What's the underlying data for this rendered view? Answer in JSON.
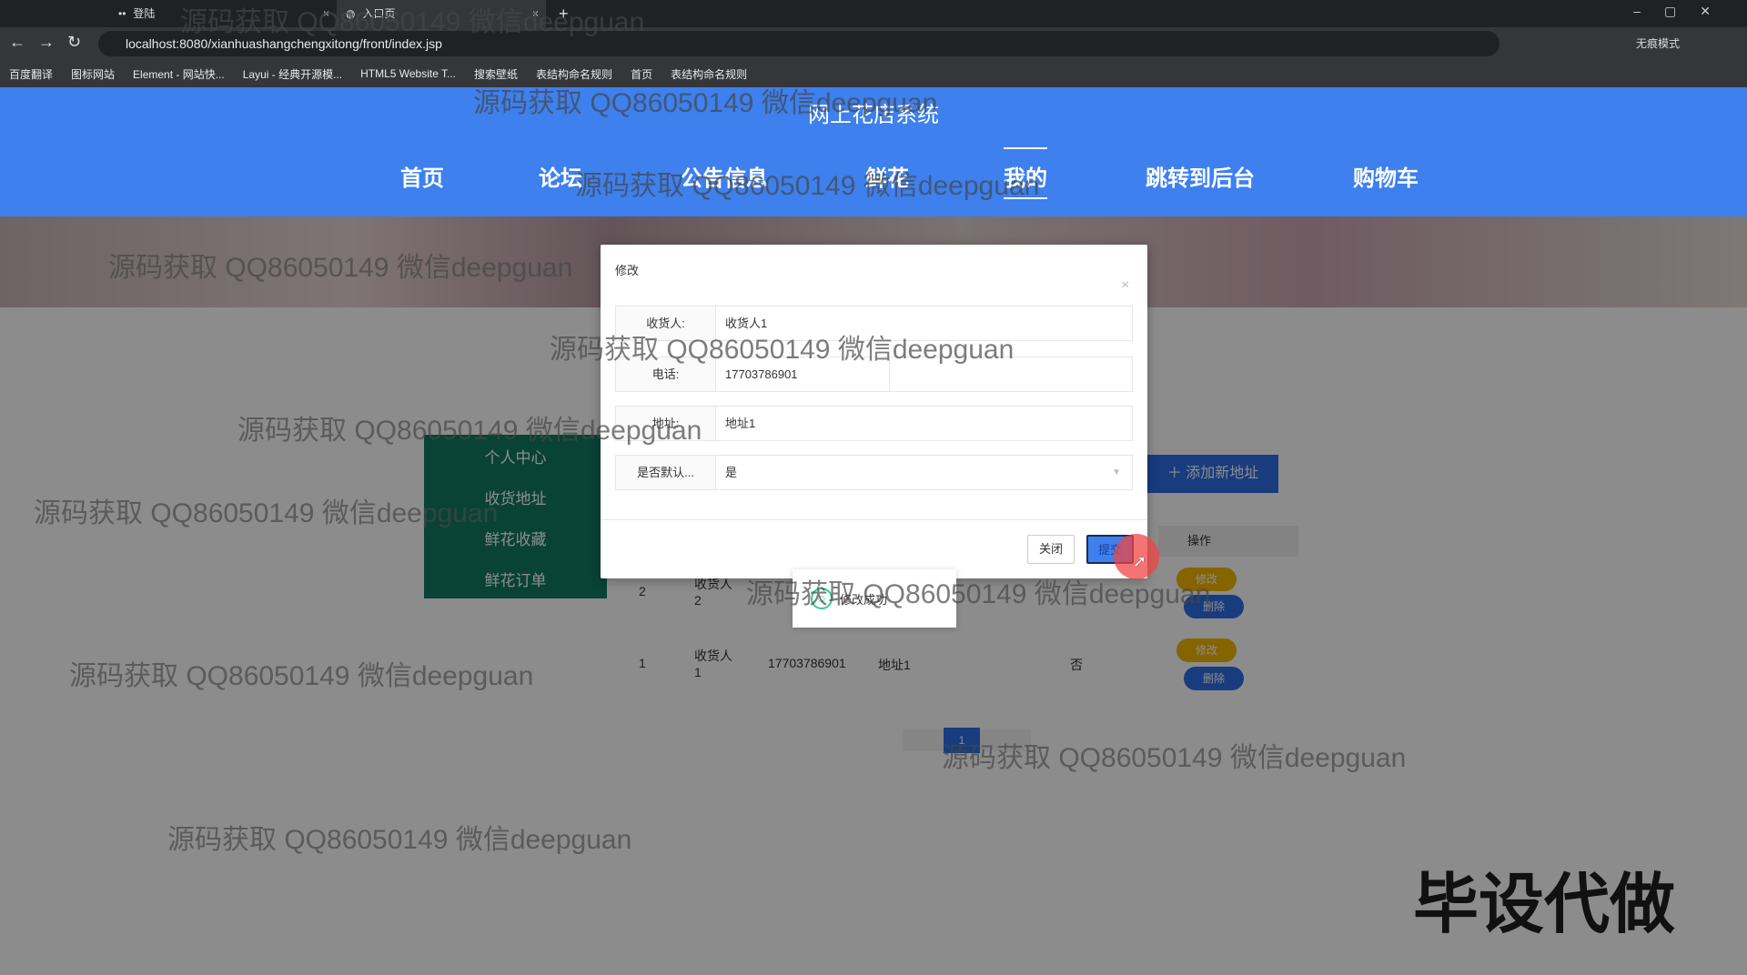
{
  "browser": {
    "tabs": [
      {
        "label": "登陆"
      },
      {
        "label": "入口页"
      }
    ],
    "new_tab": "+",
    "url": "localhost:8080/xianhuashangchengxitong/front/index.jsp",
    "profile": "无痕模式",
    "bookmarks": [
      "百度翻译",
      "图标网站",
      "Element - 网站快...",
      "Layui - 经典开源模...",
      "HTML5 Website T...",
      "搜索壁纸",
      "表结构命名规则",
      "首页",
      "表结构命名规则"
    ]
  },
  "header": {
    "title": "网上花店系统",
    "nav": [
      "首页",
      "论坛",
      "公告信息",
      "鲜花",
      "我的",
      "跳转到后台",
      "购物车"
    ],
    "active": "我的"
  },
  "sidebar": [
    "个人中心",
    "收货地址",
    "鲜花收藏",
    "鲜花订单"
  ],
  "add_button": "添加新地址",
  "table": {
    "header_action": "操作",
    "rows": [
      {
        "no": "2",
        "name": "收货人2",
        "phone": "",
        "address": "",
        "default": "",
        "edit": "修改",
        "delete": "删除"
      },
      {
        "no": "1",
        "name": "收货人1",
        "phone": "17703786901",
        "address": "地址1",
        "default": "否",
        "edit": "修改",
        "delete": "删除"
      }
    ]
  },
  "pager": {
    "current": "1"
  },
  "dialog": {
    "title": "修改",
    "close": "×",
    "fields": [
      {
        "label": "收货人:",
        "value": "收货人1"
      },
      {
        "label": "电话:",
        "value": "17703786901"
      },
      {
        "label": "地址:",
        "value": "地址1"
      },
      {
        "label": "是否默认...",
        "value": "是"
      }
    ],
    "cancel": "关闭",
    "submit": "提交"
  },
  "toast": "修改成功",
  "watermark": "源码获取 QQ86050149 微信deepguan",
  "promo": "毕设代做",
  "colors": {
    "header": "#3d80ee",
    "sidebar": "#0f7a62",
    "primary": "#2e6ee6",
    "edit": "#f2b705"
  }
}
